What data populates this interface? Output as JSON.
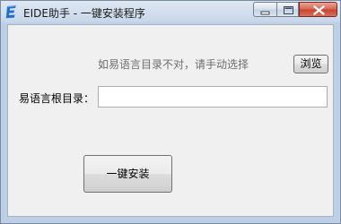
{
  "window": {
    "title": "EIDE助手 - 一键安装程序",
    "icon": "eide-app-icon",
    "controls": {
      "minimize_icon": "minimize-icon",
      "maximize_icon": "maximize-icon",
      "close_icon": "close-icon"
    }
  },
  "content": {
    "hint_text": "如易语言目录不对，请手动选择",
    "browse_label": "浏览",
    "path_label": "易语言根目录：",
    "path_value": "",
    "install_label": "一键安装"
  },
  "colors": {
    "accent_icon": "#1f6fc9",
    "close_button": "#c7432d",
    "hint_text": "#6d6d6d"
  }
}
